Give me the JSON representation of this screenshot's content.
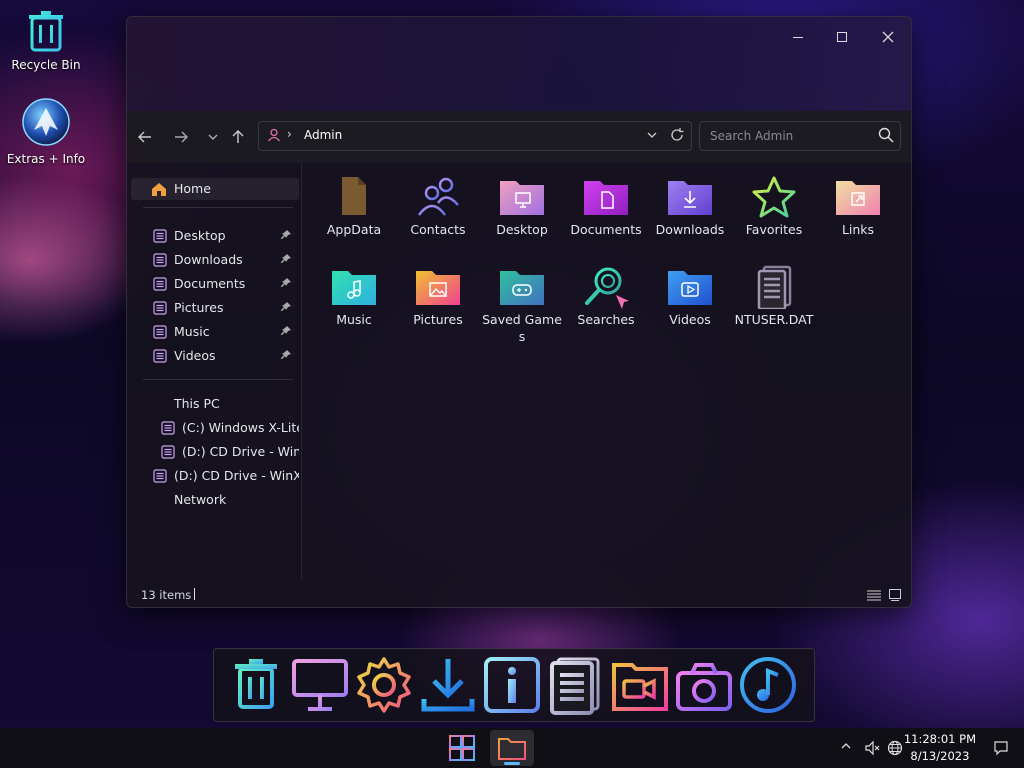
{
  "desktop": {
    "icons": [
      {
        "label": "Recycle Bin",
        "icon": "recycle-bin-icon"
      },
      {
        "label": "Extras + Info",
        "icon": "extras-info-icon"
      }
    ]
  },
  "explorer": {
    "address": {
      "crumb": "Admin",
      "separator": "›"
    },
    "search": {
      "placeholder": "Search Admin"
    },
    "sidebar": {
      "home": "Home",
      "quick_access": [
        {
          "label": "Desktop"
        },
        {
          "label": "Downloads"
        },
        {
          "label": "Documents"
        },
        {
          "label": "Pictures"
        },
        {
          "label": "Music"
        },
        {
          "label": "Videos"
        }
      ],
      "this_pc": "This PC",
      "drives": [
        {
          "label": "(C:) Windows X-Lite"
        },
        {
          "label": "(D:) CD Drive - WinX"
        },
        {
          "label": "(D:) CD Drive - WinXL"
        }
      ],
      "network": "Network"
    },
    "items": [
      {
        "name": "AppData",
        "icon": "appdata-folder-icon",
        "color": "#8a6a3a"
      },
      {
        "name": "Contacts",
        "icon": "contacts-icon",
        "color": "#8a6ae0"
      },
      {
        "name": "Desktop",
        "icon": "desktop-folder-icon",
        "color": "#e070a8"
      },
      {
        "name": "Documents",
        "icon": "documents-folder-icon",
        "color": "#c040e0"
      },
      {
        "name": "Downloads",
        "icon": "downloads-folder-icon",
        "color": "#8a70f0"
      },
      {
        "name": "Favorites",
        "icon": "favorites-star-icon",
        "color": "#c0e040"
      },
      {
        "name": "Links",
        "icon": "links-folder-icon",
        "color": "#f0a0b0"
      },
      {
        "name": "Music",
        "icon": "music-folder-icon",
        "color": "#30d0c0"
      },
      {
        "name": "Pictures",
        "icon": "pictures-folder-icon",
        "color": "#f0a040"
      },
      {
        "name": "Saved Games",
        "icon": "saved-games-folder-icon",
        "color": "#40b0c0"
      },
      {
        "name": "Searches",
        "icon": "searches-icon",
        "color": "#30d0a0"
      },
      {
        "name": "Videos",
        "icon": "videos-folder-icon",
        "color": "#3080f0"
      },
      {
        "name": "NTUSER.DAT",
        "icon": "ntuser-file-icon",
        "color": "#9a90b0"
      }
    ],
    "status": {
      "count": "13 items"
    }
  },
  "dock": {
    "icons": [
      "recycle-bin-icon",
      "monitor-icon",
      "gear-icon",
      "download-icon",
      "info-icon",
      "document-icon",
      "video-camera-icon",
      "camera-icon",
      "music-note-icon"
    ]
  },
  "taskbar": {
    "clock": {
      "time": "11:28:01 PM",
      "date": "8/13/2023"
    }
  }
}
